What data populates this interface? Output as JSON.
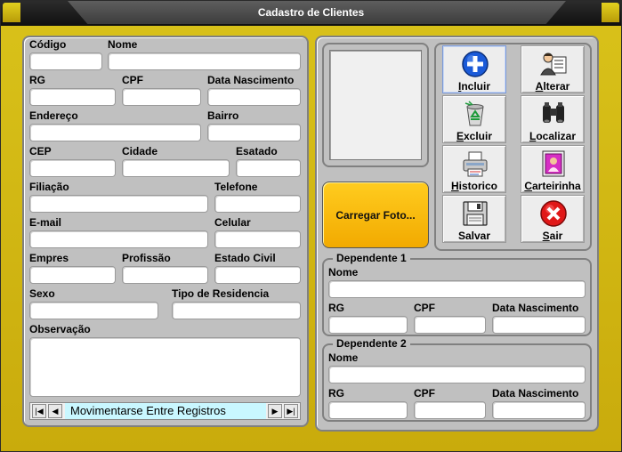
{
  "window": {
    "title": "Cadastro de Clientes"
  },
  "form": {
    "codigo": "Código",
    "nome": "Nome",
    "rg": "RG",
    "cpf": "CPF",
    "data_nascimento": "Data Nascimento",
    "endereco": "Endereço",
    "bairro": "Bairro",
    "cep": "CEP",
    "cidade": "Cidade",
    "estado": "Esatado",
    "filiacao": "Filiação",
    "telefone": "Telefone",
    "email": "E-mail",
    "celular": "Celular",
    "empresa": "Empres",
    "profissao": "Profissão",
    "estado_civil": "Estado Civil",
    "sexo": "Sexo",
    "tipo_residencia": "Tipo de Residencia",
    "observacao": "Observação"
  },
  "navigator": {
    "label": "Movimentarse Entre Registros"
  },
  "photo": {
    "load_button": "Carregar Foto..."
  },
  "toolbar": {
    "incluir": {
      "first": "I",
      "rest": "ncluir"
    },
    "alterar": {
      "first": "A",
      "rest": "lterar"
    },
    "excluir": {
      "first": "E",
      "rest": "xcluir"
    },
    "localizar": {
      "first": "L",
      "rest": "ocalizar"
    },
    "historico": {
      "first": "H",
      "rest": "istorico"
    },
    "carteirinha": {
      "first": "C",
      "rest": "arteirinha"
    },
    "salvar": {
      "first": "",
      "rest": "Salvar"
    },
    "sair": {
      "first": "S",
      "rest": "air"
    }
  },
  "dependente1": {
    "title": "Dependente 1",
    "nome": "Nome",
    "rg": "RG",
    "cpf": "CPF",
    "data_nascimento": "Data Nascimento"
  },
  "dependente2": {
    "title": "Dependente 2",
    "nome": "Nome",
    "rg": "RG",
    "cpf": "CPF",
    "data_nascimento": "Data Nascimento"
  },
  "colors": {
    "frame": "#d4b814",
    "panel": "#c0c0c0",
    "load_button": "#f9bb0a",
    "nav_highlight": "#c9f7ff"
  }
}
